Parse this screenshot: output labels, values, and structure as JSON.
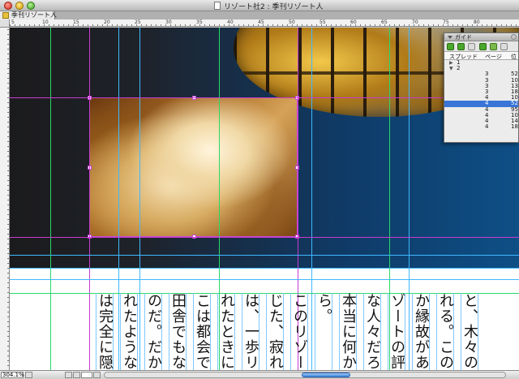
{
  "window": {
    "title": "リゾート社2 : 季刊リゾート人"
  },
  "tab": {
    "label": "季刊リゾート人"
  },
  "ruler": {
    "top_labels": [
      "5",
      "10",
      "15",
      "20",
      "25",
      "30",
      "35",
      "40",
      "45",
      "50",
      "55",
      "60",
      "65",
      "70",
      "75",
      "80"
    ]
  },
  "guides_panel": {
    "title": "ガイド",
    "columns": [
      "スプレッド",
      "ページ",
      "位"
    ],
    "spreads": [
      {
        "label": "1",
        "expanded": false
      },
      {
        "label": "2",
        "expanded": true
      }
    ],
    "rows": [
      {
        "page": "3",
        "pos": "52",
        "selected": false
      },
      {
        "page": "3",
        "pos": "10",
        "selected": false
      },
      {
        "page": "3",
        "pos": "13",
        "selected": false
      },
      {
        "page": "3",
        "pos": "18",
        "selected": false
      },
      {
        "page": "4",
        "pos": "10",
        "selected": false
      },
      {
        "page": "4",
        "pos": "52",
        "selected": true
      },
      {
        "page": "4",
        "pos": "95",
        "selected": false
      },
      {
        "page": "4",
        "pos": "10",
        "selected": false
      },
      {
        "page": "4",
        "pos": "14",
        "selected": false
      },
      {
        "page": "4",
        "pos": "18",
        "selected": false
      }
    ]
  },
  "body_columns": [
    "は完全に隠",
    "れたような",
    "のだ。だか",
    "田舎でもな",
    "こは都会で",
    "れたときに",
    "は、一歩リ",
    "じた、寂れ",
    "このリゾー",
    "ら。",
    "本当に何か",
    "な人々だろ",
    "ゾートの評",
    "か縁故があ",
    "れる。この",
    "と、木々の"
  ],
  "status": {
    "zoom": "304.1%"
  },
  "colors": {
    "guide_green": "#29d96a",
    "guide_cyan": "#3fb8ff",
    "guide_magenta": "#c93ad2",
    "selection": "#c34ad6",
    "panel_selected": "#3875d7"
  }
}
